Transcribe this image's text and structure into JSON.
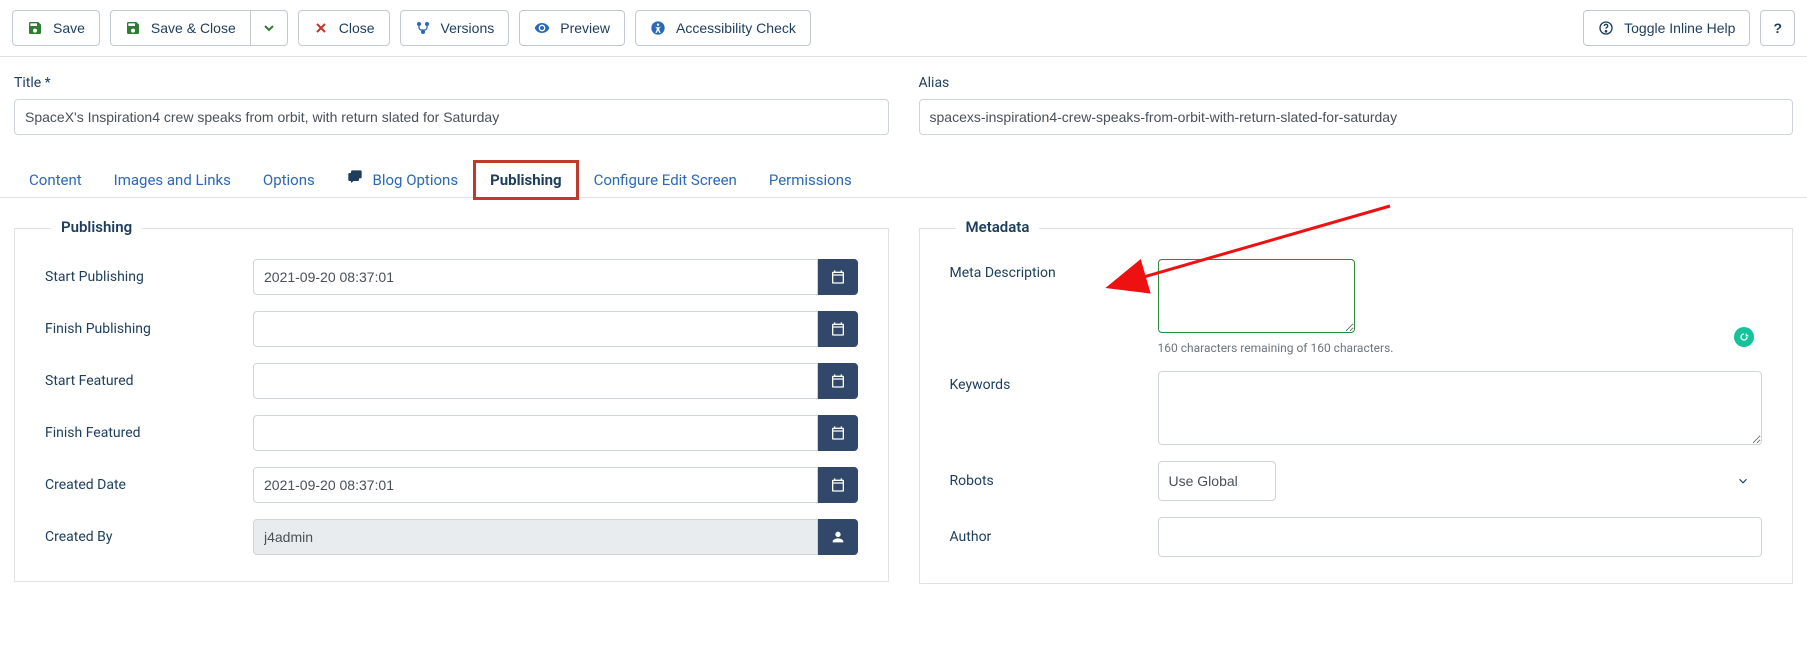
{
  "toolbar": {
    "save": "Save",
    "save_close": "Save & Close",
    "close": "Close",
    "versions": "Versions",
    "preview": "Preview",
    "accessibility": "Accessibility Check",
    "toggle_help": "Toggle Inline Help",
    "help": "?"
  },
  "title_section": {
    "title_label": "Title *",
    "title_value": "SpaceX's Inspiration4 crew speaks from orbit, with return slated for Saturday",
    "alias_label": "Alias",
    "alias_value": "spacexs-inspiration4-crew-speaks-from-orbit-with-return-slated-for-saturday"
  },
  "tabs": [
    {
      "label": "Content"
    },
    {
      "label": "Images and Links"
    },
    {
      "label": "Options"
    },
    {
      "label": "Blog Options",
      "icon": true
    },
    {
      "label": "Publishing",
      "active": true
    },
    {
      "label": "Configure Edit Screen"
    },
    {
      "label": "Permissions"
    }
  ],
  "publishing": {
    "legend": "Publishing",
    "start_publishing": {
      "label": "Start Publishing",
      "value": "2021-09-20 08:37:01"
    },
    "finish_publishing": {
      "label": "Finish Publishing",
      "value": ""
    },
    "start_featured": {
      "label": "Start Featured",
      "value": ""
    },
    "finish_featured": {
      "label": "Finish Featured",
      "value": ""
    },
    "created_date": {
      "label": "Created Date",
      "value": "2021-09-20 08:37:01"
    },
    "created_by": {
      "label": "Created By",
      "value": "j4admin"
    }
  },
  "metadata": {
    "legend": "Metadata",
    "meta_desc": {
      "label": "Meta Description",
      "value": "",
      "hint": "160 characters remaining of 160 characters."
    },
    "keywords": {
      "label": "Keywords",
      "value": ""
    },
    "robots": {
      "label": "Robots",
      "value": "Use Global"
    },
    "author": {
      "label": "Author",
      "value": ""
    }
  }
}
